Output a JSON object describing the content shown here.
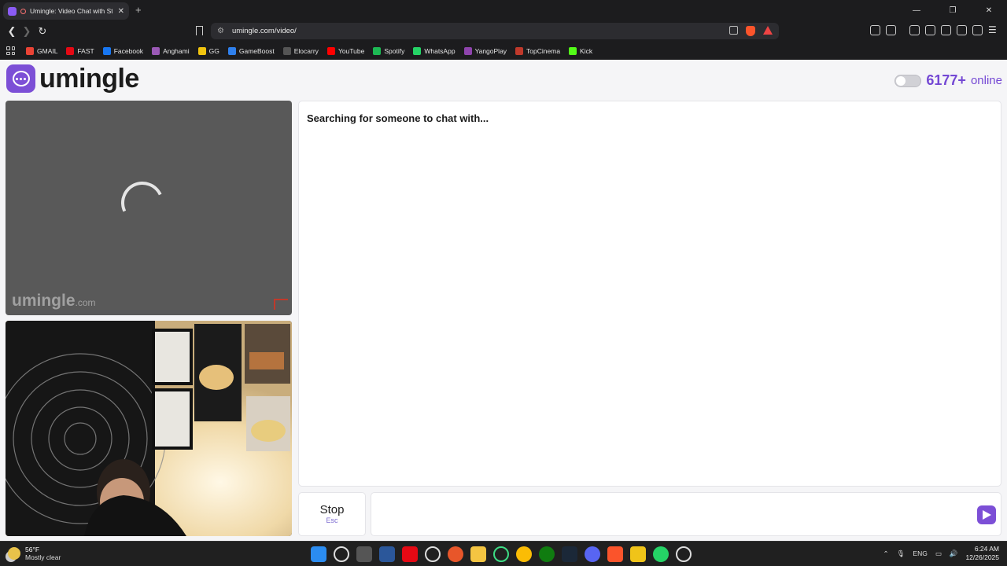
{
  "browser": {
    "tab_title": "Umingle: Video Chat with Str",
    "url": "umingle.com/video/"
  },
  "bookmarks": [
    {
      "label": "GMAIL",
      "color": "#ea4335"
    },
    {
      "label": "FAST",
      "color": "#e50914"
    },
    {
      "label": "Facebook",
      "color": "#1877f2"
    },
    {
      "label": "Anghami",
      "color": "#9b59b6"
    },
    {
      "label": "GG",
      "color": "#f1c40f"
    },
    {
      "label": "GameBoost",
      "color": "#2f80ed"
    },
    {
      "label": "Elocarry",
      "color": "#555555"
    },
    {
      "label": "YouTube",
      "color": "#ff0000"
    },
    {
      "label": "Spotify",
      "color": "#1db954"
    },
    {
      "label": "WhatsApp",
      "color": "#25d366"
    },
    {
      "label": "YangoPlay",
      "color": "#8e44ad"
    },
    {
      "label": "TopCinema",
      "color": "#c0392b"
    },
    {
      "label": "Kick",
      "color": "#53fc18"
    }
  ],
  "site": {
    "logo_text": "umingle",
    "online_count": "6177+",
    "online_label": "online",
    "watermark_main": "umingle",
    "watermark_suffix": ".com",
    "status_text": "Searching for someone to chat with...",
    "stop_label": "Stop",
    "stop_shortcut": "Esc",
    "accent_color": "#7c4fd6"
  },
  "taskbar": {
    "temperature": "56°F",
    "weather": "Mostly clear",
    "language": "ENG",
    "time": "6:24 AM",
    "date": "12/26/2025"
  }
}
